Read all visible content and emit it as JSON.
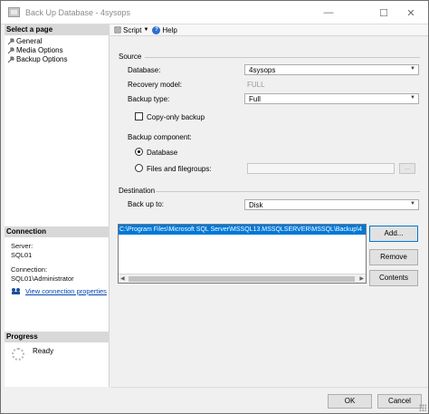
{
  "window": {
    "title": "Back Up Database - 4sysops"
  },
  "left": {
    "select_page_heading": "Select a page",
    "pages": [
      {
        "label": "General"
      },
      {
        "label": "Media Options"
      },
      {
        "label": "Backup Options"
      }
    ],
    "connection_heading": "Connection",
    "server_label": "Server:",
    "server_value": "SQL01",
    "connection_label": "Connection:",
    "connection_value": "SQL01\\Administrator",
    "view_link": "View connection properties",
    "progress_heading": "Progress",
    "progress_status": "Ready"
  },
  "toolbar": {
    "script_label": "Script",
    "help_label": "Help"
  },
  "source": {
    "heading": "Source",
    "database_label": "Database:",
    "database_value": "4sysops",
    "recovery_label": "Recovery model:",
    "recovery_value": "FULL",
    "backup_type_label": "Backup type:",
    "backup_type_value": "Full",
    "copy_only_label": "Copy-only backup",
    "copy_only_checked": false,
    "component_label": "Backup component:",
    "component_database": "Database",
    "component_files": "Files and filegroups:",
    "selected_component": "Database"
  },
  "destination": {
    "heading": "Destination",
    "backup_to_label": "Back up to:",
    "backup_to_value": "Disk",
    "paths": [
      "C:\\Program Files\\Microsoft SQL Server\\MSSQL13.MSSQLSERVER\\MSSQL\\Backup\\4"
    ],
    "add_label": "Add...",
    "remove_label": "Remove",
    "contents_label": "Contents"
  },
  "footer": {
    "ok_label": "OK",
    "cancel_label": "Cancel"
  },
  "colors": {
    "selection": "#0078d7",
    "link": "#0645ad"
  }
}
